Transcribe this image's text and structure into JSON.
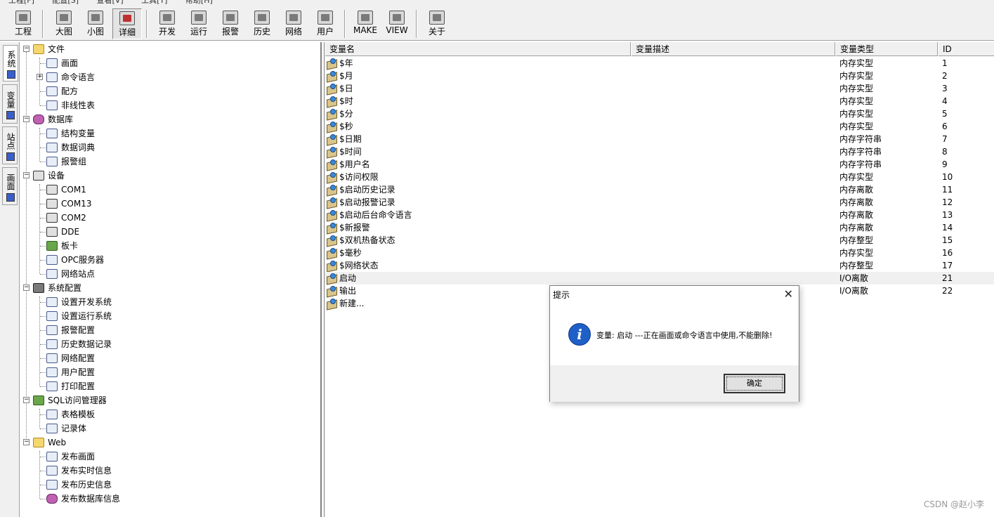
{
  "menu": [
    "工程[F]",
    "配置[S]",
    "查看[V]",
    "工具[T]",
    "帮助[H]"
  ],
  "toolbar": {
    "buttons": [
      "工程",
      "大图",
      "小图",
      "详细",
      "开发",
      "运行",
      "报警",
      "历史",
      "网络",
      "用户",
      "MAKE",
      "VIEW",
      "关于"
    ]
  },
  "sidetabs": [
    "系统",
    "变量",
    "站点",
    "画面"
  ],
  "tree": {
    "file": "文件",
    "file_children": [
      "画面",
      "命令语言",
      "配方",
      "非线性表"
    ],
    "database": "数据库",
    "database_children": [
      "结构变量",
      "数据词典",
      "报警组"
    ],
    "device": "设备",
    "device_children": [
      "COM1",
      "COM13",
      "COM2",
      "DDE",
      "板卡",
      "OPC服务器",
      "网络站点"
    ],
    "sysconfig": "系统配置",
    "sysconfig_children": [
      "设置开发系统",
      "设置运行系统",
      "报警配置",
      "历史数据记录",
      "网络配置",
      "用户配置",
      "打印配置"
    ],
    "sql": "SQL访问管理器",
    "sql_children": [
      "表格模板",
      "记录体"
    ],
    "web": "Web",
    "web_children": [
      "发布画面",
      "发布实时信息",
      "发布历史信息",
      "发布数据库信息"
    ]
  },
  "list": {
    "headers": [
      "变量名",
      "变量描述",
      "变量类型",
      "ID"
    ],
    "rows": [
      {
        "name": "$年",
        "desc": "",
        "type": "内存实型",
        "id": "1"
      },
      {
        "name": "$月",
        "desc": "",
        "type": "内存实型",
        "id": "2"
      },
      {
        "name": "$日",
        "desc": "",
        "type": "内存实型",
        "id": "3"
      },
      {
        "name": "$时",
        "desc": "",
        "type": "内存实型",
        "id": "4"
      },
      {
        "name": "$分",
        "desc": "",
        "type": "内存实型",
        "id": "5"
      },
      {
        "name": "$秒",
        "desc": "",
        "type": "内存实型",
        "id": "6"
      },
      {
        "name": "$日期",
        "desc": "",
        "type": "内存字符串",
        "id": "7"
      },
      {
        "name": "$时间",
        "desc": "",
        "type": "内存字符串",
        "id": "8"
      },
      {
        "name": "$用户名",
        "desc": "",
        "type": "内存字符串",
        "id": "9"
      },
      {
        "name": "$访问权限",
        "desc": "",
        "type": "内存实型",
        "id": "10"
      },
      {
        "name": "$启动历史记录",
        "desc": "",
        "type": "内存离散",
        "id": "11"
      },
      {
        "name": "$启动报警记录",
        "desc": "",
        "type": "内存离散",
        "id": "12"
      },
      {
        "name": "$启动后台命令语言",
        "desc": "",
        "type": "内存离散",
        "id": "13"
      },
      {
        "name": "$新报警",
        "desc": "",
        "type": "内存离散",
        "id": "14"
      },
      {
        "name": "$双机热备状态",
        "desc": "",
        "type": "内存整型",
        "id": "15"
      },
      {
        "name": "$毫秒",
        "desc": "",
        "type": "内存实型",
        "id": "16"
      },
      {
        "name": "$网络状态",
        "desc": "",
        "type": "内存整型",
        "id": "17"
      },
      {
        "name": "启动",
        "desc": "",
        "type": "I/O离散",
        "id": "21"
      },
      {
        "name": "输出",
        "desc": "",
        "type": "I/O离散",
        "id": "22"
      },
      {
        "name": "新建...",
        "desc": "",
        "type": "",
        "id": ""
      }
    ]
  },
  "dialog": {
    "title": "提示",
    "close": "✕",
    "message": "变量: 启动 ---正在画面或命令语言中使用,不能删除!",
    "ok": "确定"
  },
  "watermark": "CSDN @赵小李"
}
